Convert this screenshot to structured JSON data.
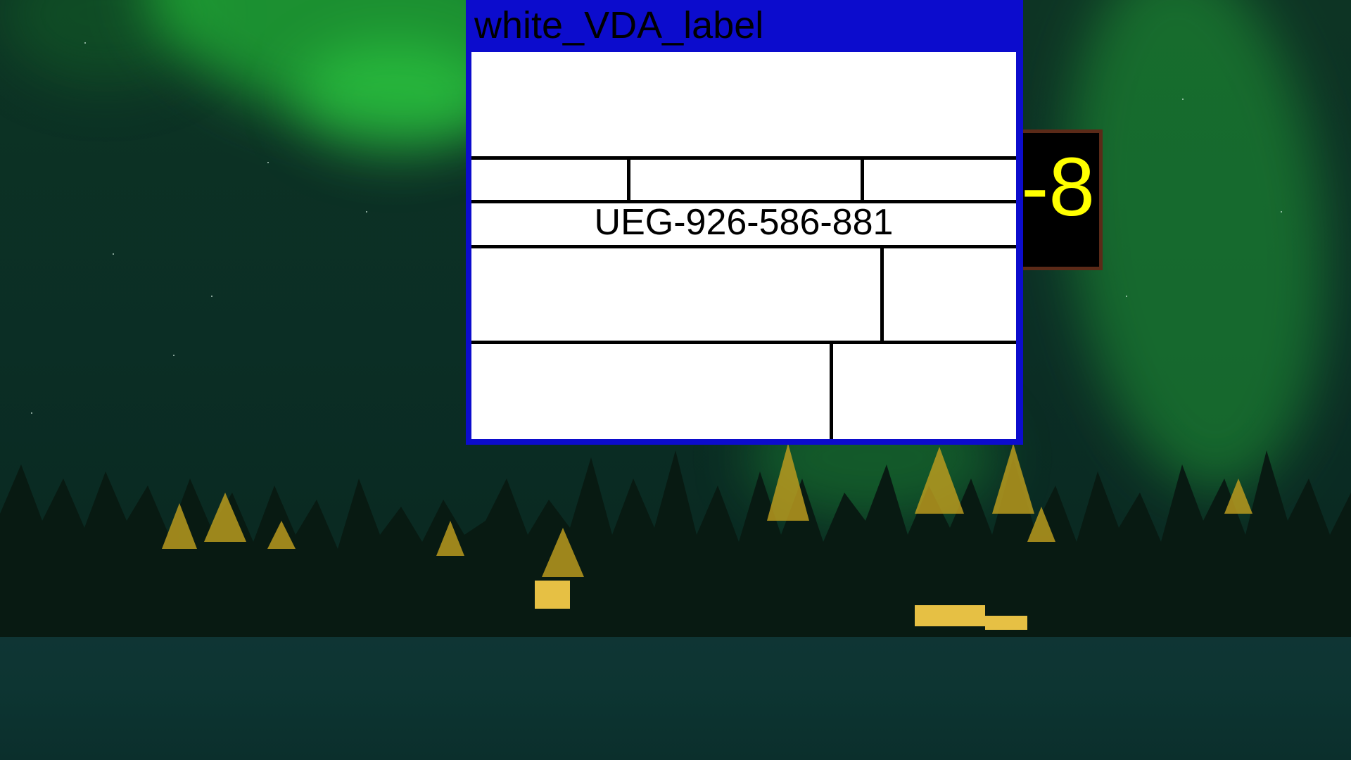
{
  "background": {
    "scene": "aurora-night-forest",
    "colors": {
      "sky": "#0d3424",
      "aurora": "#28dc3c",
      "snow": "#0d3532",
      "lights": "#ffd34a"
    }
  },
  "counter": {
    "text": "-8",
    "text_color": "#ffff00",
    "background_color": "#000000",
    "border_color": "#5b2a18"
  },
  "label_window": {
    "title": "white_VDA_label",
    "frame_color": "#0c0ccd",
    "body_color": "#ffffff",
    "fields": {
      "header": "",
      "row2_col1": "",
      "row2_col2": "",
      "row2_col3": "",
      "code": "UEG-926-586-881",
      "row4_col1": "",
      "row4_col2": "",
      "row5_col1": "",
      "row5_col2": ""
    }
  }
}
